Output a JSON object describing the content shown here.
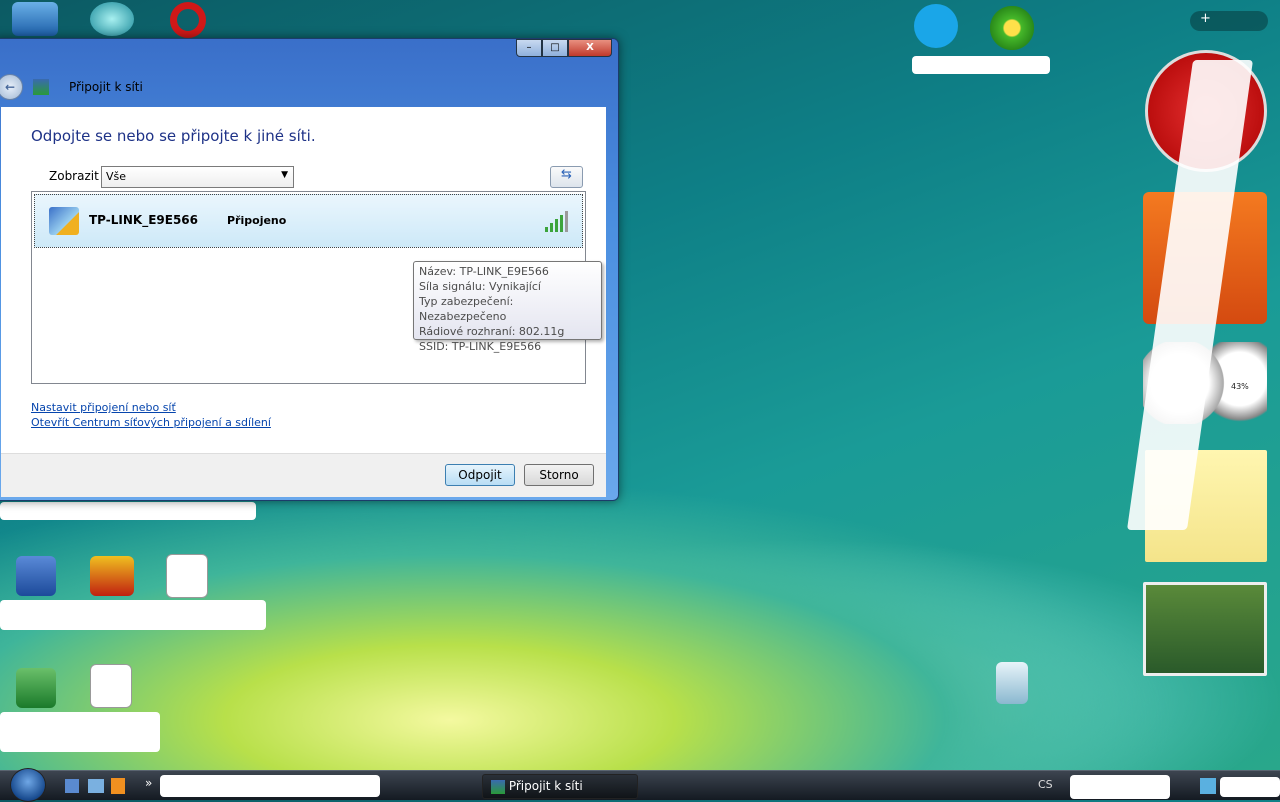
{
  "window": {
    "title": "Připojit k síti",
    "heading": "Odpojte se nebo se připojte k jiné síti.",
    "show_label": "Zobrazit",
    "show_value": "Vše",
    "network": {
      "name": "TP-LINK_E9E566",
      "status": "Připojeno",
      "signal_bars": 5
    },
    "tooltip": [
      "Název: TP-LINK_E9E566",
      "Síla signálu: Vynikající",
      "Typ zabezpečení: Nezabezpečeno",
      "Rádiové rozhraní: 802.11g",
      "SSID: TP-LINK_E9E566"
    ],
    "links": [
      "Nastavit připojení nebo síť",
      "Otevřít Centrum síťových připojení a sdílení"
    ],
    "buttons": {
      "disconnect": "Odpojit",
      "cancel": "Storno"
    },
    "caption": {
      "close": "X"
    }
  },
  "taskbar": {
    "active_task": "Připojit k síti",
    "language": "CS",
    "quicklaunch_more": "»"
  },
  "sidebar": {
    "cpu_percent": "43%"
  },
  "colors": {
    "heading": "#1e3287",
    "link": "#0645ad",
    "signal": "#3ca43c"
  }
}
